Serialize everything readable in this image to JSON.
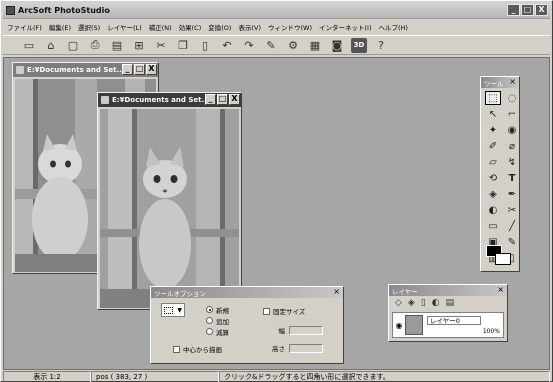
{
  "app": {
    "title": "ArcSoft PhotoStudio"
  },
  "window_controls": {
    "minimize": "_",
    "maximize": "□",
    "close": "X"
  },
  "menu": [
    "ファイル(F)",
    "編集(E)",
    "選択(S)",
    "レイヤー(L)",
    "補正(N)",
    "効果(C)",
    "変換(O)",
    "表示(V)",
    "ウィンドウ(W)",
    "インターネット(I)",
    "ヘルプ(H)"
  ],
  "toolbar": {
    "icons": [
      "new-icon",
      "open-icon",
      "save-icon",
      "scan-icon",
      "print-icon",
      "email-icon",
      "cut-icon",
      "copy-icon",
      "paste-icon",
      "undo-icon",
      "redo-icon",
      "wand-icon",
      "lasso-icon",
      "browse-icon",
      "camera-icon",
      "3d-icon",
      "help-icon"
    ],
    "glyphs": [
      "▭",
      "⌂",
      "▢",
      "⎙",
      "▤",
      "⊞",
      "✂",
      "❐",
      "▯",
      "↶",
      "↷",
      "✎",
      "⚙",
      "▦",
      "◙",
      "3D",
      "?"
    ]
  },
  "documents": [
    {
      "title": "E:¥Documents and Set..."
    },
    {
      "title": "E:¥Documents and Set..."
    }
  ],
  "tools_panel": {
    "title": "ツール",
    "close": "×",
    "glyphs": [
      "⬚",
      "◌",
      "↖",
      "⌐",
      "✦",
      "◉",
      "✐",
      "⌀",
      "▱",
      "↯",
      "⟲",
      "T",
      "◈",
      "✒",
      "◐",
      "✂",
      "▭",
      "╱",
      "▣",
      "✎",
      "▥",
      "▯"
    ]
  },
  "layers_panel": {
    "title": "レイヤー",
    "close": "×",
    "layer_name": "レイヤー0",
    "opacity": "100%"
  },
  "tool_options": {
    "title": "ツールオプション",
    "close": "×",
    "modes": [
      "新規",
      "追加",
      "減算"
    ],
    "selected_mode": "新規",
    "fixed_size_label": "固定サイズ",
    "width_label": "幅",
    "height_label": "高さ",
    "from_center_label": "中心から描画"
  },
  "status": {
    "zoom": "表示 1:2",
    "pos": "pos ( 383, 27 )",
    "hint": "クリック&ドラッグすると四角い形に選択できます。"
  }
}
